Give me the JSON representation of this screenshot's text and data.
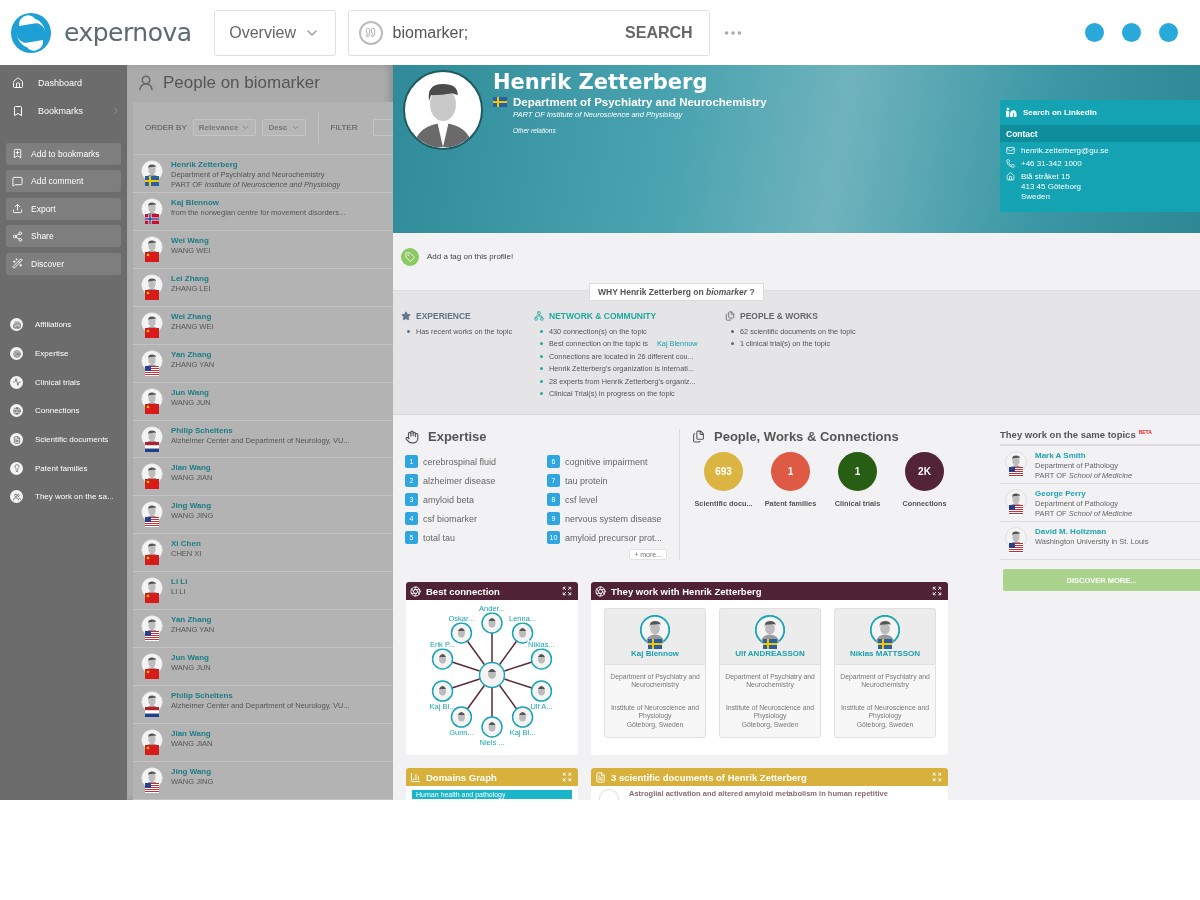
{
  "topbar": {
    "logo": "expernova",
    "view_select": "Overview",
    "search": {
      "value": "biomarker;",
      "button": "SEARCH"
    }
  },
  "sidebar": {
    "nav": [
      {
        "label": "Dashboard",
        "kind": "home"
      },
      {
        "label": "Bookmarks",
        "kind": "bookmarks"
      }
    ],
    "actions": [
      {
        "label": "Add to bookmarks",
        "kind": "bookmark"
      },
      {
        "label": "Add comment",
        "kind": "comment"
      },
      {
        "label": "Export",
        "kind": "export"
      },
      {
        "label": "Share",
        "kind": "share"
      },
      {
        "label": "Discover",
        "kind": "discover"
      }
    ],
    "sections": [
      {
        "label": "Affiliations",
        "kind": "affiliations"
      },
      {
        "label": "Expertise",
        "kind": "expertise"
      },
      {
        "label": "Clinical trials",
        "kind": "trials"
      },
      {
        "label": "Connections",
        "kind": "connections"
      },
      {
        "label": "Scientific documents",
        "kind": "documents"
      },
      {
        "label": "Patent families",
        "kind": "patents"
      },
      {
        "label": "They work on the sa...",
        "kind": "same"
      }
    ]
  },
  "people_list": {
    "title": "People on biomarker",
    "order_label": "ORDER BY",
    "order_by": "Relevance",
    "direction": "Desc",
    "filter_label": "FILTER",
    "rows": [
      {
        "name": "Henrik Zetterberg",
        "line_1": "Department of Psychiatry and Neurochemistry",
        "line_2": "PART OF *Institute of Neuroscience and Physiology*",
        "kind": "se"
      },
      {
        "name": "Kaj Blennow",
        "line_1": "from the norwegian centre for movement disorders...",
        "kind": "no"
      },
      {
        "name": "Wei Wang",
        "line_1": "WANG WEI",
        "kind": "cn"
      },
      {
        "name": "Lei Zhang",
        "line_1": "ZHANG LEI",
        "kind": "cn"
      },
      {
        "name": "Wei Zhang",
        "line_1": "ZHANG WEI",
        "kind": "cn"
      },
      {
        "name": "Yan Zhang",
        "line_1": "ZHANG YAN",
        "kind": "us"
      },
      {
        "name": "Jun Wang",
        "line_1": "WANG JUN",
        "kind": "cn"
      },
      {
        "name": "Philip Scheltens",
        "line_1": "Alzheimer Center and Department of Neurology, VU...",
        "kind": "nl"
      },
      {
        "name": "Jian Wang",
        "line_1": "WANG JIAN",
        "kind": "cn"
      },
      {
        "name": "Jing Wang",
        "line_1": "WANG JING",
        "kind": "us"
      },
      {
        "name": "Xi Chen",
        "line_1": "CHEN XI",
        "kind": "cn"
      },
      {
        "name": "Li Li",
        "line_1": "LI LI",
        "kind": "cn"
      },
      {
        "name": "Yan Zhang",
        "line_1": "ZHANG YAN",
        "kind": "us"
      },
      {
        "name": "Jun Wang",
        "line_1": "WANG JUN",
        "kind": "cn"
      },
      {
        "name": "Philip Scheltens",
        "line_1": "Alzheimer Center and Department of Neurology, VU...",
        "kind": "nl"
      },
      {
        "name": "Jian Wang",
        "line_1": "WANG JIAN",
        "kind": "cn"
      },
      {
        "name": "Jing Wang",
        "line_1": "WANG JING",
        "kind": "us"
      }
    ]
  },
  "profile": {
    "name": "Henrik Zetterberg",
    "kind": "se",
    "department": "Department of Psychiatry and Neurochemistry",
    "part_of": "PART OF Institute of Neuroscience and Physiology",
    "other_relations": "Other relations",
    "linkedin": "Search on LinkedIn",
    "contact_title": "Contact",
    "contact": [
      {
        "kind": "email",
        "lines": [
          "henrik.zetterberg@gu.se"
        ]
      },
      {
        "kind": "phone",
        "lines": [
          "+46 31-342 1000"
        ]
      },
      {
        "kind": "address",
        "lines": [
          "Blå stråket 15",
          "413 45 Göteborg",
          "Sweden"
        ]
      }
    ]
  },
  "tag_prompt": "Add a tag on this profile!",
  "why": {
    "title": "WHY Henrik Zetterberg on *biomarker* ?",
    "columns": [
      {
        "kind": "experience",
        "heading": "EXPERIENCE",
        "items": [
          {
            "text": "Has recent works on the topic"
          }
        ]
      },
      {
        "kind": "network",
        "heading": "NETWORK & COMMUNITY",
        "items": [
          {
            "text": "430 connection(s) on the topic"
          },
          {
            "text": "Best connection on the topic is",
            "link": "Kaj Blennow"
          },
          {
            "text": "Connections are located in 26 different cou..."
          },
          {
            "text": "Henrik Zetterberg's organization is internati..."
          },
          {
            "text": "28 experts from Henrik Zetterberg's organiz..."
          },
          {
            "text": "Clinical Trial(s) in progress on the topic"
          }
        ]
      },
      {
        "kind": "works",
        "heading": "PEOPLE & WORKS",
        "items": [
          {
            "text": "62 scientific documents on the topic"
          },
          {
            "text": "1 clinical trial(s) on the topic"
          }
        ]
      }
    ]
  },
  "expertise": {
    "title": "Expertise",
    "items": [
      {
        "number": "1",
        "label": "cerebrospinal fluid"
      },
      {
        "number": "2",
        "label": "alzheimer disease"
      },
      {
        "number": "3",
        "label": "amyloid beta"
      },
      {
        "number": "4",
        "label": "csf biomarker"
      },
      {
        "number": "5",
        "label": "total tau"
      },
      {
        "number": "6",
        "label": "cognitive impairment"
      },
      {
        "number": "7",
        "label": "tau protein"
      },
      {
        "number": "8",
        "label": "csf level"
      },
      {
        "number": "9",
        "label": "nervous system disease"
      },
      {
        "number": "10",
        "label": "amyloid precursor prot..."
      }
    ],
    "more": "+ more..."
  },
  "works": {
    "title": "People, Works & Connections",
    "stats": [
      {
        "value": "693",
        "label": "Scientific docu...",
        "color": "#dbb441"
      },
      {
        "value": "1",
        "label": "Patent families",
        "color": "#de5a44"
      },
      {
        "value": "1",
        "label": "Clinical trials",
        "color": "#275e14"
      },
      {
        "value": "2K",
        "label": "Connections",
        "color": "#532438"
      }
    ]
  },
  "same_topics": {
    "title": "They work on the same topics",
    "badge": "BETA",
    "people": [
      {
        "name": "Mark A Smith",
        "line_1": "Department of Pathology",
        "line_2": "PART OF *School of Medicine*",
        "kind": "us"
      },
      {
        "name": "George Perry",
        "line_1": "Department of Pathology",
        "line_2": "PART OF *School of Medicine*",
        "kind": "us"
      },
      {
        "name": "David M. Holtzman",
        "line_1": "Washington University in St. Louis",
        "kind": "us"
      }
    ],
    "button": "DISCOVER MORE..."
  },
  "best_connection": {
    "title": "Best connection",
    "nodes": [
      "Ander...",
      "Oskar...",
      "Lenna...",
      "Erik P...",
      "Niklas...",
      "Kaj Bl...",
      "Ulf A...",
      "Gunn...",
      "Kaj Bl...",
      "Niels ..."
    ]
  },
  "coworkers": {
    "title": "They work with Henrik Zetterberg",
    "people": [
      {
        "name": "Kaj Blennow",
        "kind": "se",
        "department": "Department of Psychiatry and Neurochemistry",
        "institute": "Institute of Neuroscience and Physiology",
        "place": "Göteborg, Sweden"
      },
      {
        "name": "Ulf ANDREASSON",
        "kind": "se",
        "department": "Department of Psychiatry and Neurochemistry",
        "institute": "Institute of Neuroscience and Physiology",
        "place": "Göteborg, Sweden"
      },
      {
        "name": "Niklas MATTSSON",
        "kind": "se",
        "department": "Department of Psychiatry and Neurochemistry",
        "institute": "Institute of Neuroscience and Physiology",
        "place": "Göteborg, Sweden"
      }
    ]
  },
  "domains": {
    "title": "Domains Graph",
    "first_domain": "Human health and pathology"
  },
  "documents": {
    "title": "3 scientific documents of Henrik Zetterberg",
    "first_title": "Astroglial activation and altered amyloid metabolism in human repetitive"
  }
}
